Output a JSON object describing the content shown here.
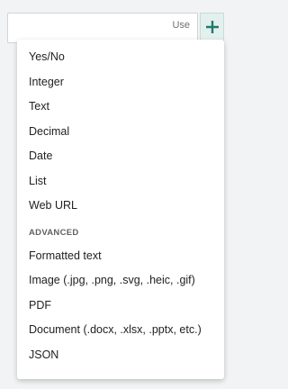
{
  "header": {
    "use_label": "Use",
    "add_icon": "plus-icon",
    "accent_color": "#1f7a6d"
  },
  "menu": {
    "basic_items": [
      {
        "label": "Yes/No"
      },
      {
        "label": "Integer"
      },
      {
        "label": "Text"
      },
      {
        "label": "Decimal"
      },
      {
        "label": "Date"
      },
      {
        "label": "List"
      },
      {
        "label": "Web URL"
      }
    ],
    "advanced_header": "ADVANCED",
    "advanced_items": [
      {
        "label": "Formatted text"
      },
      {
        "label": "Image (.jpg, .png, .svg, .heic, .gif)"
      },
      {
        "label": "PDF"
      },
      {
        "label": "Document (.docx, .xlsx, .pptx, etc.)"
      },
      {
        "label": "JSON"
      }
    ]
  }
}
